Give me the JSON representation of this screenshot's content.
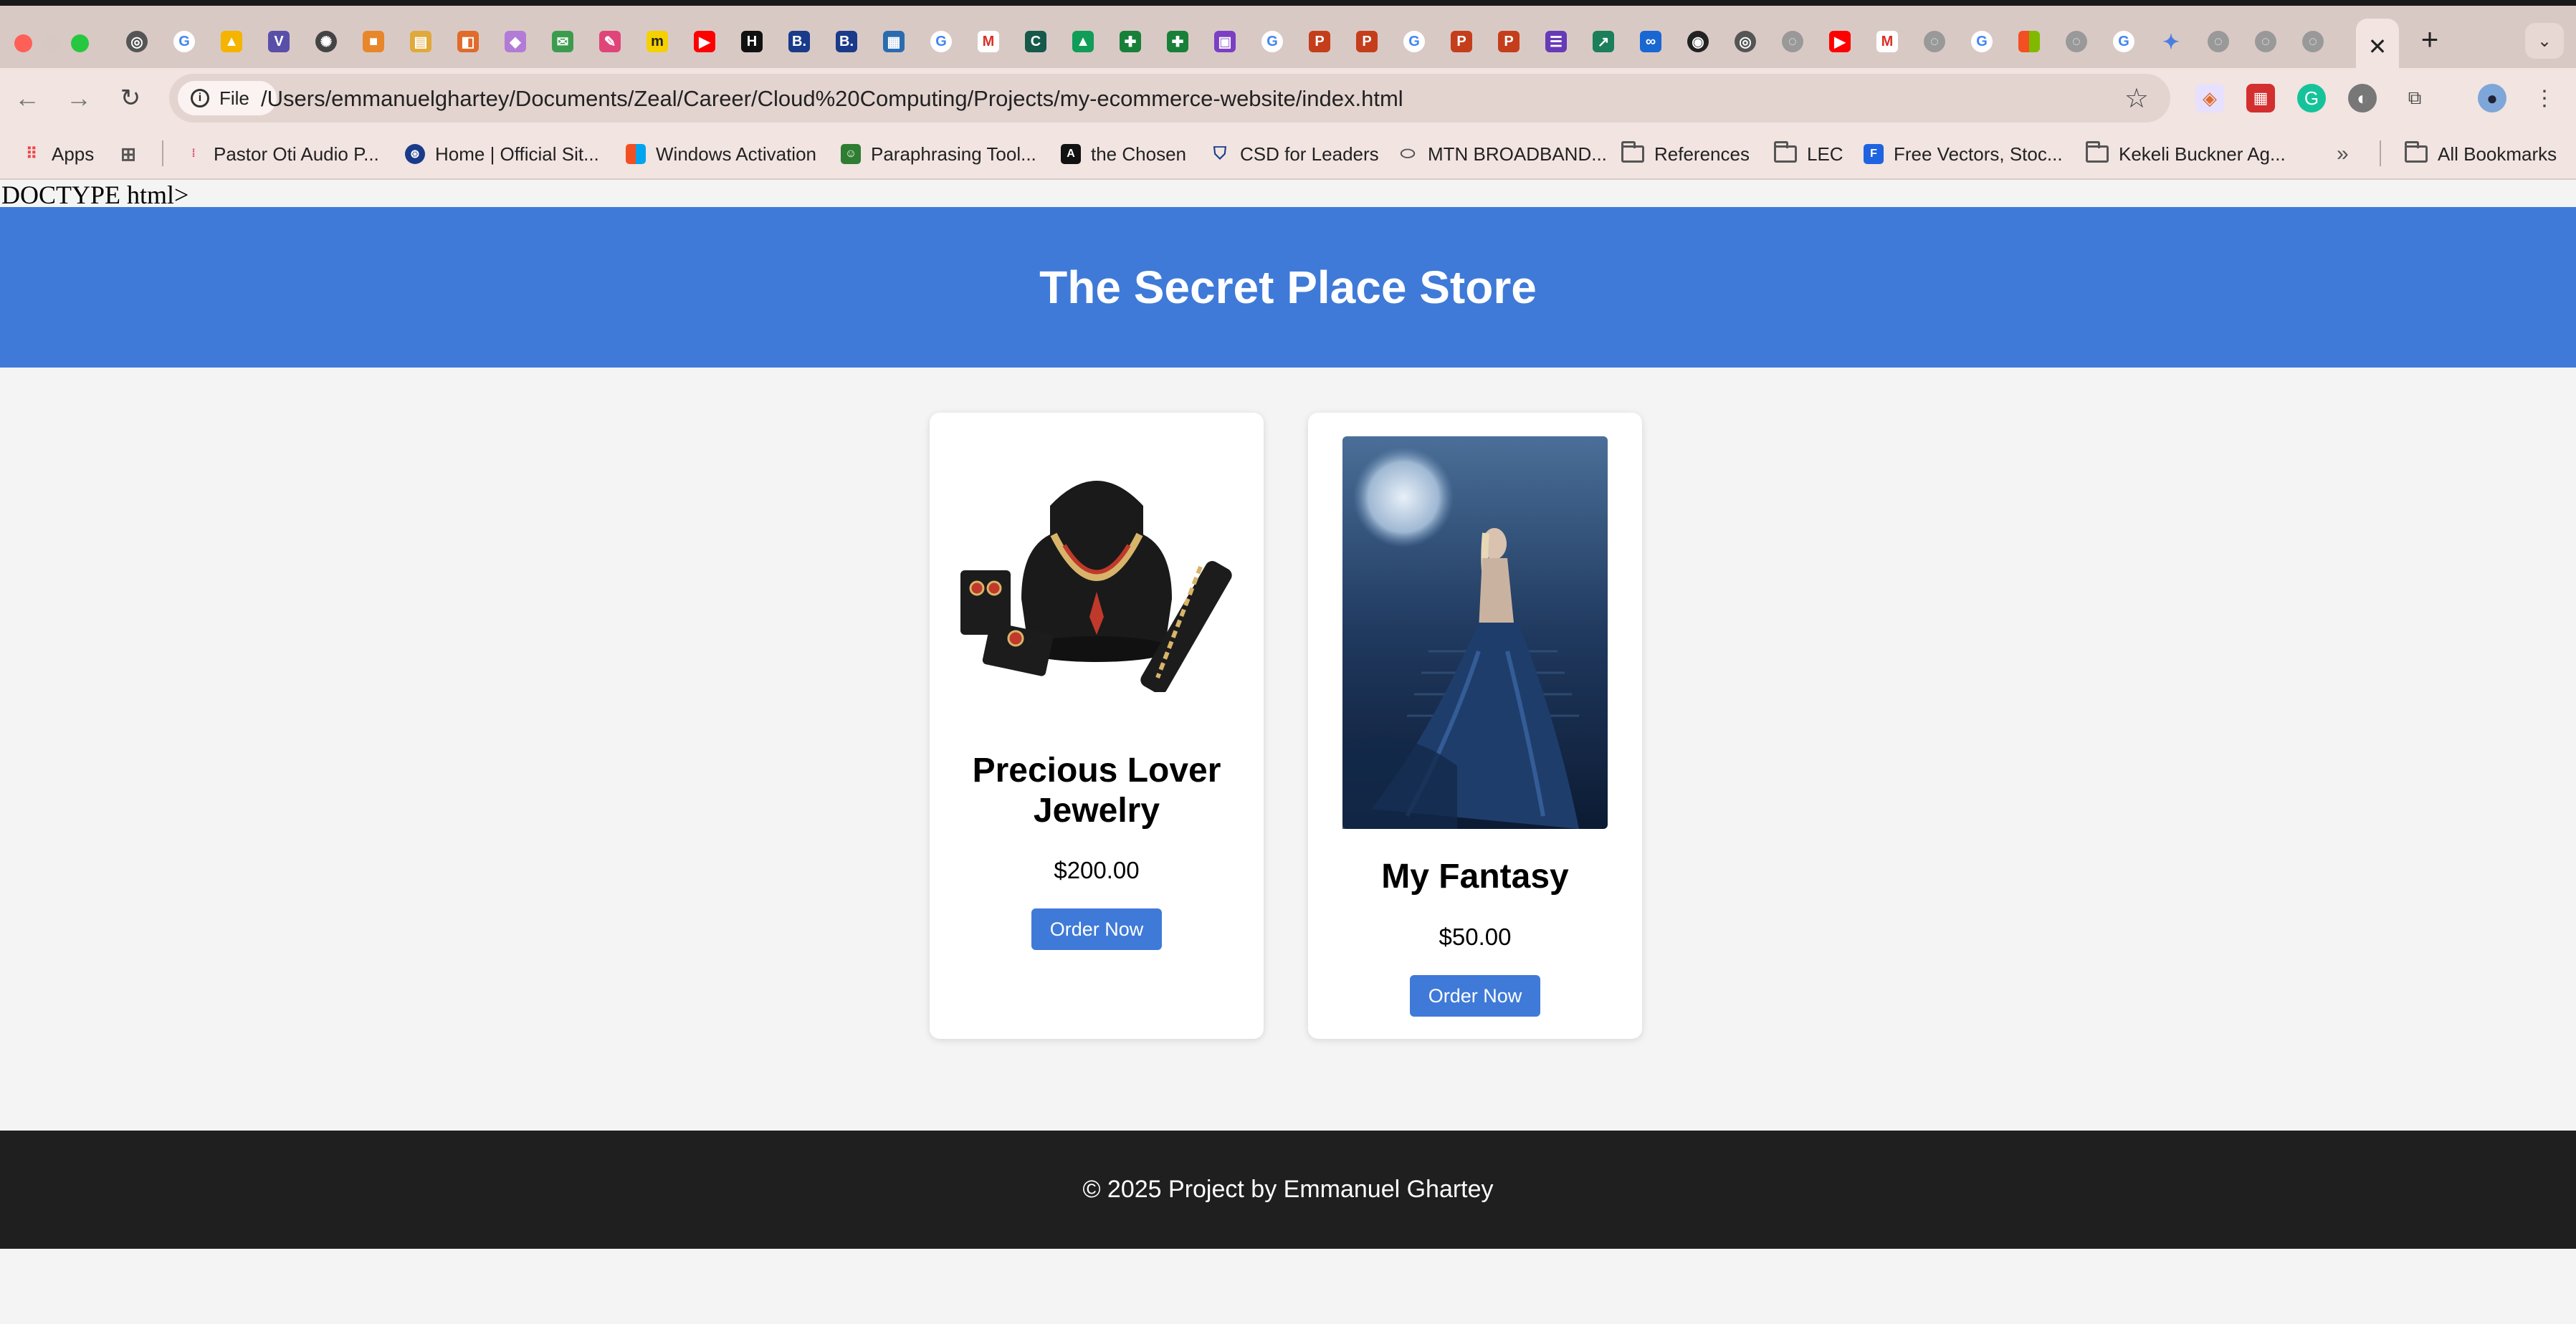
{
  "browser": {
    "address_bar": {
      "scheme_label": "File",
      "url": "/Users/emmanuelghartey/Documents/Zeal/Career/Cloud%20Computing/Projects/my-ecommerce-website/index.html"
    },
    "bookmarks": [
      {
        "label": "Apps"
      },
      {
        "label": "Pastor Oti Audio P..."
      },
      {
        "label": "Home | Official Sit..."
      },
      {
        "label": "Windows Activation"
      },
      {
        "label": "Paraphrasing Tool..."
      },
      {
        "label": "the Chosen"
      },
      {
        "label": "CSD for Leaders"
      },
      {
        "label": "MTN BROADBAND..."
      },
      {
        "label": "References"
      },
      {
        "label": "LEC"
      },
      {
        "label": "Free Vectors, Stoc..."
      },
      {
        "label": "Kekeli Buckner Ag..."
      },
      {
        "label": "All Bookmarks"
      }
    ]
  },
  "page": {
    "doctype_text": "DOCTYPE html>",
    "header_title": "The Secret Place Store",
    "products": [
      {
        "name": "Precious Lover Jewelry",
        "price": "$200.00",
        "button": "Order Now"
      },
      {
        "name": "My Fantasy",
        "price": "$50.00",
        "button": "Order Now"
      }
    ],
    "footer_text": "© 2025 Project by Emmanuel Ghartey"
  }
}
